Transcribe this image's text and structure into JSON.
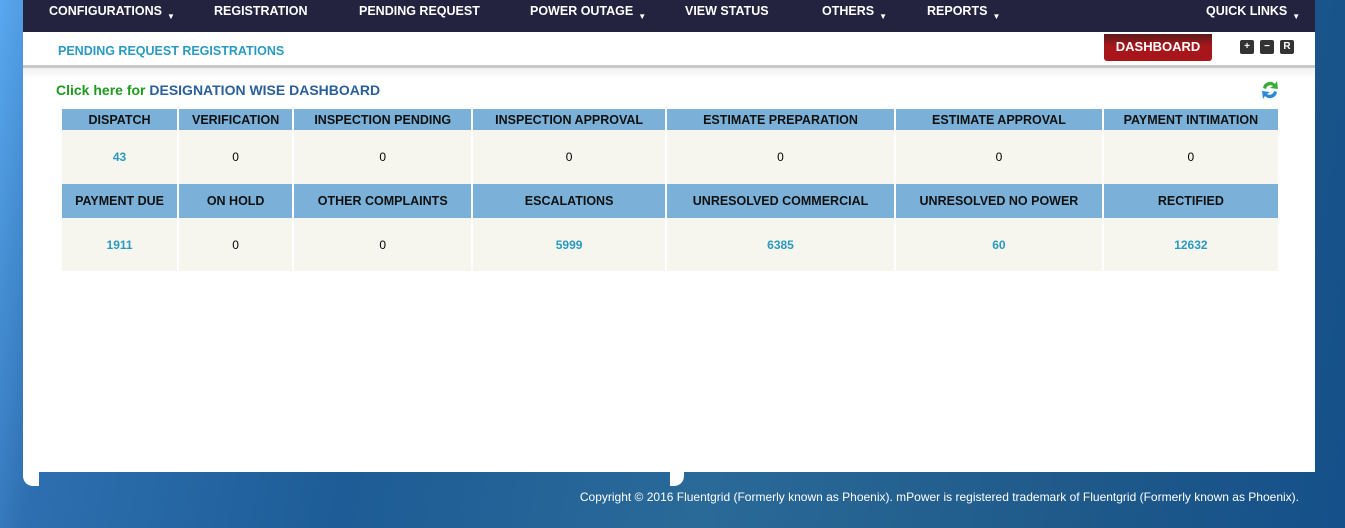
{
  "nav": {
    "items": [
      {
        "label": "CONFIGURATIONS",
        "dropdown": true
      },
      {
        "label": "REGISTRATION",
        "dropdown": false
      },
      {
        "label": "PENDING REQUEST",
        "dropdown": false
      },
      {
        "label": "POWER OUTAGE",
        "dropdown": true
      },
      {
        "label": "VIEW STATUS",
        "dropdown": false
      },
      {
        "label": "OTHERS",
        "dropdown": true
      },
      {
        "label": "REPORTS",
        "dropdown": true
      },
      {
        "label": "QUICK LINKS",
        "dropdown": true
      }
    ],
    "caret": "▼"
  },
  "header": {
    "title": "PENDING REQUEST REGISTRATIONS",
    "dashboard_label": "DASHBOARD",
    "zoom_in": "+",
    "zoom_out": "−",
    "reset": "R"
  },
  "link": {
    "prefix": "Click here for",
    "text": "DESIGNATION WISE DASHBOARD"
  },
  "table": {
    "rows": [
      {
        "headers": [
          "DISPATCH",
          "VERIFICATION",
          "INSPECTION PENDING",
          "INSPECTION APPROVAL",
          "ESTIMATE PREPARATION",
          "ESTIMATE APPROVAL",
          "PAYMENT INTIMATION"
        ],
        "values": [
          "43",
          "0",
          "0",
          "0",
          "0",
          "0",
          "0"
        ]
      },
      {
        "headers": [
          "PAYMENT DUE",
          "ON HOLD",
          "OTHER COMPLAINTS",
          "ESCALATIONS",
          "UNRESOLVED COMMERCIAL",
          "UNRESOLVED NO POWER",
          "RECTIFIED"
        ],
        "values": [
          "1911",
          "0",
          "0",
          "5999",
          "6385",
          "60",
          "12632"
        ]
      }
    ]
  },
  "footer": {
    "copyright": "Copyright © 2016 Fluentgrid (Formerly known as Phoenix). mPower is registered trademark of Fluentgrid (Formerly known as Phoenix)."
  }
}
